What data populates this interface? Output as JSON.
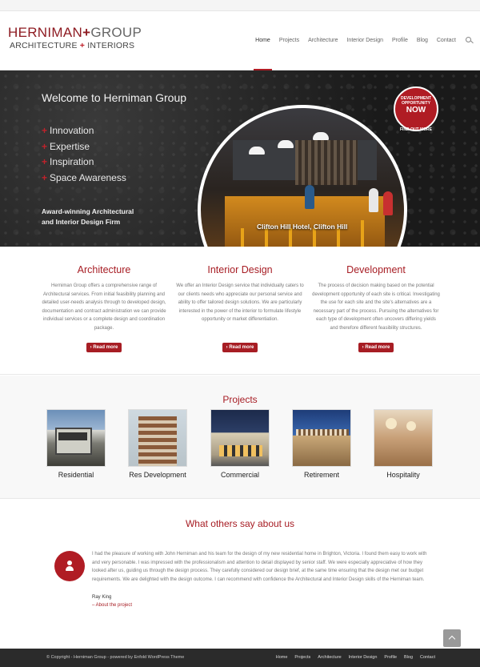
{
  "brand": {
    "line1_a": "Herniman",
    "line1_plus": "+",
    "line1_b": "Group",
    "line2_a": "Architecture",
    "line2_plus": "+",
    "line2_b": "Interiors"
  },
  "nav": {
    "items": [
      "Home",
      "Projects",
      "Architecture",
      "Interior Design",
      "Profile",
      "Blog",
      "Contact"
    ],
    "active": "Home",
    "search_icon": "search-icon"
  },
  "hero": {
    "title": "Welcome to Herniman Group",
    "list": [
      "Innovation",
      "Expertise",
      "Inspiration",
      "Space Awareness"
    ],
    "list_marker": "+",
    "award_line1": "Award-winning Architectural",
    "award_line2": "and Interior Design Firm",
    "caption": "Clifton Hill Hotel, Clifton Hill",
    "badge_line1": "DEVELOPMENT",
    "badge_line2": "OPPORTUNITY",
    "badge_line3": "NOW",
    "badge_link": "FIND OUT MORE"
  },
  "services": [
    {
      "title": "Architecture",
      "text": "Herniman Group offers a comprehensive range of Architectural services. From initial feasibility planning and detailed user-needs analysis through to developed design, documentation and contract administration we can provide individual services or a complete design and coordination package.",
      "button": "› Read more"
    },
    {
      "title": "Interior Design",
      "text": "We offer an Interior Design service that individually caters to our clients needs who appreciate our personal service and ability to offer tailored design solutions. We are particularly interested in the power of the interior to formulate lifestyle opportunity or market differentiation.",
      "button": "› Read more"
    },
    {
      "title": "Development",
      "text": "The process of decision making based on the potential development opportunity of each site is critical. Investigating the use for each site and the site's alternatives are a necessary part of the process. Pursuing the alternatives for each type of development often uncovers differing yields and therefore different feasibility structures.",
      "button": "› Read more"
    }
  ],
  "projects": {
    "title": "Projects",
    "items": [
      "Residential",
      "Res Development",
      "Commercial",
      "Retirement",
      "Hospitality"
    ]
  },
  "testimonials": {
    "title": "What others say about us",
    "quote": "I had the pleasure of working with John Herniman and his team for the design of my new residential home in Brighton, Victoria. I found them easy to work with and very personable. I was impressed with the professionalism and attention to detail displayed by senior staff. We were especially appreciative of how they looked after us, guiding us through the design process. They carefully considered our design brief, at the same time ensuring that the design met our budget requirements. We are delighted with the design outcome. I can recommend with confidence the Architectural and Interior Design skills of the Herniman team.",
    "author": "Ray King",
    "link": "– About the project"
  },
  "footer": {
    "copyright": "© Copyright - Herniman Group - powered by Enfold WordPress Theme",
    "nav": [
      "Home",
      "Projects",
      "Architecture",
      "Interior Design",
      "Profile",
      "Blog",
      "Contact"
    ]
  },
  "colors": {
    "accent": "#a71d24",
    "footer_bg": "#2b2b2b",
    "hero_bg": "#1a1a1a"
  }
}
